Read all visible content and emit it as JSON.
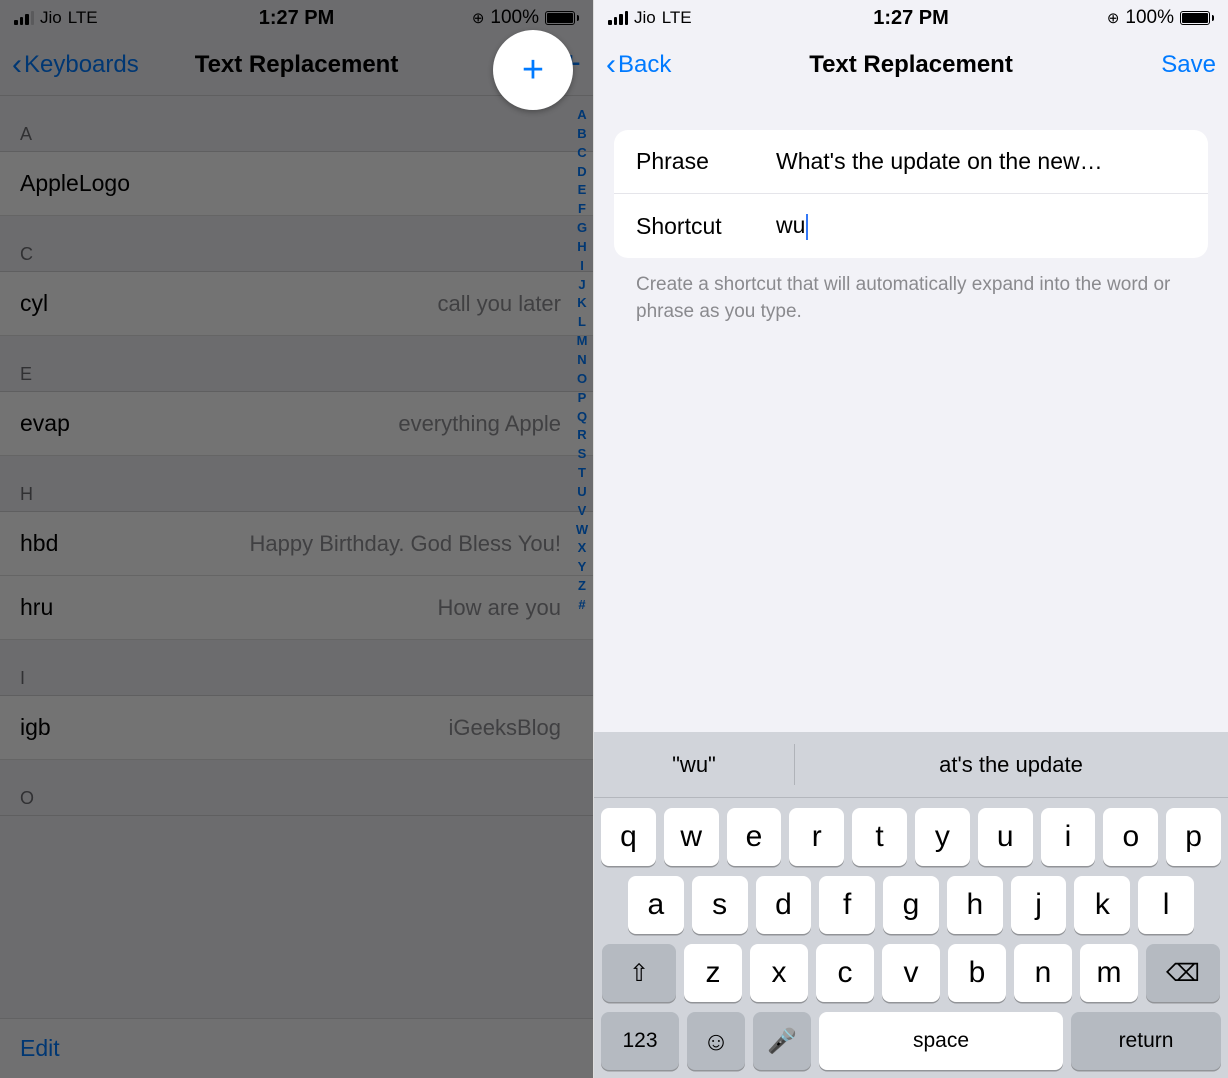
{
  "status": {
    "carrier": "Jio",
    "network": "LTE",
    "time": "1:27 PM",
    "lock_glyph": "⊕",
    "battery_pct": "100%"
  },
  "left": {
    "nav": {
      "back_label": "Keyboards",
      "title": "Text Replacement",
      "plus_label": "+",
      "edit_label": "Edit"
    },
    "sections": [
      {
        "letter": "A",
        "rows": [
          {
            "key": "AppleLogo",
            "value": ""
          }
        ]
      },
      {
        "letter": "C",
        "rows": [
          {
            "key": "cyl",
            "value": "call you later"
          }
        ]
      },
      {
        "letter": "E",
        "rows": [
          {
            "key": "evap",
            "value": "everything Apple"
          }
        ]
      },
      {
        "letter": "H",
        "rows": [
          {
            "key": "hbd",
            "value": "Happy Birthday. God Bless You!"
          },
          {
            "key": "hru",
            "value": "How are you"
          }
        ]
      },
      {
        "letter": "I",
        "rows": [
          {
            "key": "igb",
            "value": "iGeeksBlog"
          }
        ]
      },
      {
        "letter": "O",
        "rows": []
      }
    ],
    "index_letters": [
      "A",
      "B",
      "C",
      "D",
      "E",
      "F",
      "G",
      "H",
      "I",
      "J",
      "K",
      "L",
      "M",
      "N",
      "O",
      "P",
      "Q",
      "R",
      "S",
      "T",
      "U",
      "V",
      "W",
      "X",
      "Y",
      "Z",
      "#"
    ]
  },
  "right": {
    "nav": {
      "back_label": "Back",
      "title": "Text Replacement",
      "save_label": "Save"
    },
    "form": {
      "phrase_label": "Phrase",
      "phrase_value": "What's the update on the new…",
      "shortcut_label": "Shortcut",
      "shortcut_value": "wu",
      "hint": "Create a shortcut that will automatically expand into the word or phrase as you type."
    },
    "keyboard": {
      "suggestions": [
        "\"wu\"",
        "at's the update"
      ],
      "row1": [
        "q",
        "w",
        "e",
        "r",
        "t",
        "y",
        "u",
        "i",
        "o",
        "p"
      ],
      "row2": [
        "a",
        "s",
        "d",
        "f",
        "g",
        "h",
        "j",
        "k",
        "l"
      ],
      "row3": [
        "z",
        "x",
        "c",
        "v",
        "b",
        "n",
        "m"
      ],
      "shift_glyph": "⇧",
      "delete_glyph": "⌫",
      "num_label": "123",
      "emoji_glyph": "☺",
      "mic_glyph": "🎤",
      "space_label": "space",
      "return_label": "return"
    }
  }
}
